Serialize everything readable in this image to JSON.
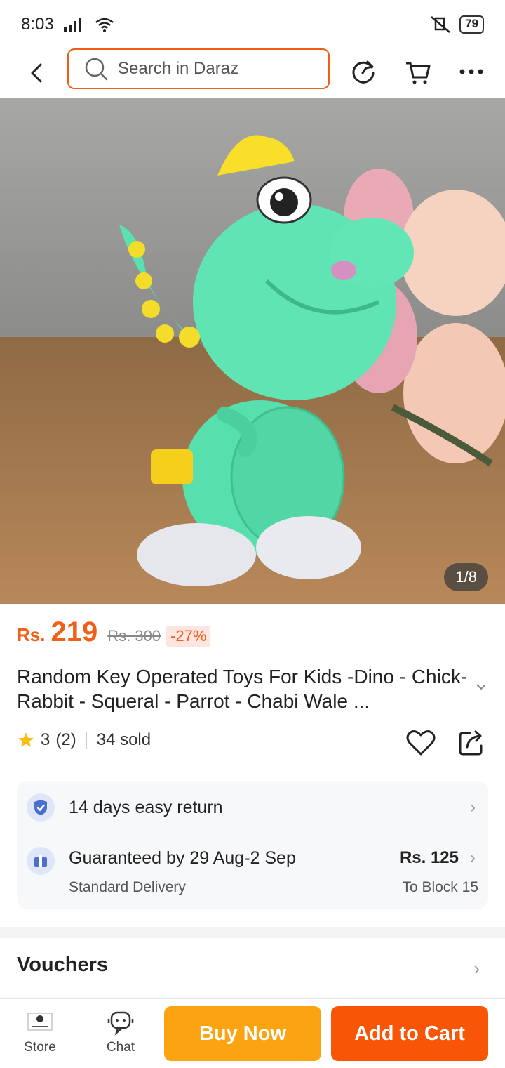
{
  "status": {
    "time": "8:03",
    "battery": "79"
  },
  "header": {
    "search_placeholder": "Search in Daraz",
    "back_icon": "chevron-left-icon",
    "icons": [
      "refresh-icon",
      "cart-icon",
      "more-icon"
    ]
  },
  "gallery": {
    "counter": "1/8"
  },
  "product": {
    "currency": "Rs.",
    "price": "219",
    "old_price": "Rs. 300",
    "discount": "-27%",
    "title": "Random Key Operated Toys For Kids -Dino - Chick- Rabbit - Squeral - Parrot - Chabi Wale ...",
    "rating": "3",
    "rating_count": "(2)",
    "sold": "34 sold"
  },
  "service": {
    "return_text": "14 days easy return",
    "delivery_title": "Guaranteed by 29 Aug-2 Sep",
    "delivery_sub": "Standard Delivery",
    "delivery_price": "Rs. 125",
    "delivery_location": "To Block 15"
  },
  "vouchers": {
    "label": "Vouchers"
  },
  "bottom": {
    "store_label": "Store",
    "chat_label": "Chat",
    "buy_now": "Buy Now",
    "add_to_cart": "Add to Cart"
  },
  "colors": {
    "accent": "#f25e17",
    "buy_now": "#fca311",
    "add_cart": "#f85606"
  }
}
